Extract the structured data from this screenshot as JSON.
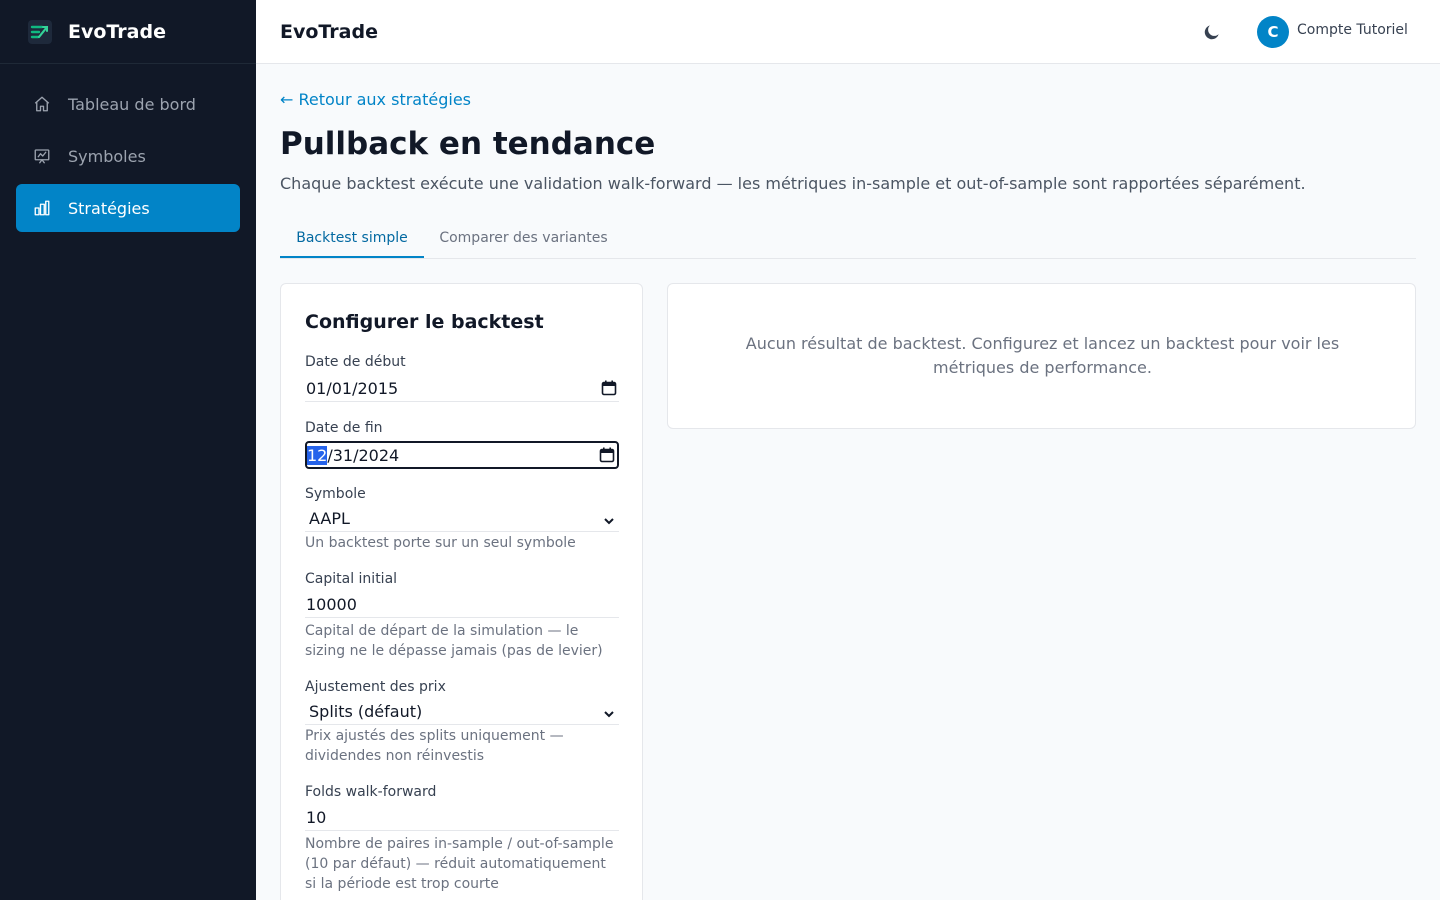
{
  "app": {
    "brand_name": "EvoTrade",
    "accent_color": "#0284c7"
  },
  "sidebar": {
    "items": [
      {
        "label": "Tableau de bord",
        "icon": "home-icon",
        "active": false
      },
      {
        "label": "Symboles",
        "icon": "chart-presentation-icon",
        "active": false
      },
      {
        "label": "Stratégies",
        "icon": "bar-chart-icon",
        "active": true
      }
    ]
  },
  "topbar": {
    "title": "EvoTrade",
    "theme_icon": "moon-icon",
    "avatar_initial": "C",
    "account_name": "Compte Tutoriel"
  },
  "page": {
    "back_link": "← Retour aux stratégies",
    "title": "Pullback en tendance",
    "subtitle": "Chaque backtest exécute une validation walk-forward — les métriques in-sample et out-of-sample sont rapportées séparément.",
    "tabs": [
      {
        "label": "Backtest simple",
        "active": true
      },
      {
        "label": "Comparer des variantes",
        "active": false
      }
    ]
  },
  "config": {
    "heading": "Configurer le backtest",
    "start_date": {
      "label": "Date de début",
      "value": "01/01/2015"
    },
    "end_date": {
      "label": "Date de fin",
      "value_selected": "12",
      "value_rest": "/31/2024"
    },
    "symbol": {
      "label": "Symbole",
      "value": "AAPL",
      "hint": "Un backtest porte sur un seul symbole"
    },
    "capital": {
      "label": "Capital initial",
      "value": "10000",
      "hint": "Capital de départ de la simulation — le sizing ne le dépasse jamais (pas de levier)"
    },
    "adjustment": {
      "label": "Ajustement des prix",
      "value": "Splits (défaut)",
      "hint": "Prix ajustés des splits uniquement — dividendes non réinvestis"
    },
    "folds": {
      "label": "Folds walk-forward",
      "value": "10",
      "hint": "Nombre de paires in-sample / out-of-sample (10 par défaut) — réduit automatiquement si la période est trop courte"
    }
  },
  "results": {
    "empty_message": "Aucun résultat de backtest. Configurez et lancez un backtest pour voir les métriques de performance."
  }
}
